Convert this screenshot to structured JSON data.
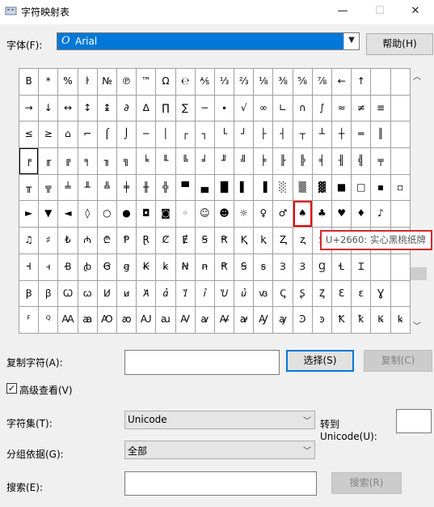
{
  "window": {
    "title": "字符映射表",
    "minimize": "—",
    "maximize": "☐",
    "close": "✕"
  },
  "font_label": "字体(F):",
  "font_value": "Arial",
  "font_icon": "O",
  "help_button": "帮助(H)",
  "grid_rows": [
    [
      "B",
      "*",
      "%",
      "ŀ",
      "№",
      "℗",
      "™",
      "Ω",
      "℮",
      "⅍",
      "⅓",
      "⅔",
      "⅛",
      "⅜",
      "⅝",
      "⅞",
      "←",
      "↑"
    ],
    [
      "→",
      "↓",
      "↔",
      "↕",
      "↨",
      "∂",
      "∆",
      "∏",
      "∑",
      "−",
      "∙",
      "√",
      "∞",
      "∟",
      "∩",
      "∫",
      "≈",
      "≠",
      "≡"
    ],
    [
      "≤",
      "≥",
      "⌂",
      "⌐",
      "⌠",
      "⌡",
      "─",
      "│",
      "┌",
      "┐",
      "└",
      "┘",
      "├",
      "┤",
      "┬",
      "┴",
      "┼",
      "═",
      "║"
    ],
    [
      "╒",
      "╓",
      "╔",
      "╕",
      "╖",
      "╗",
      "╘",
      "╙",
      "╚",
      "╛",
      "╜",
      "╝",
      "╞",
      "╟",
      "╠",
      "╡",
      "╢",
      "╣",
      "╤"
    ],
    [
      "╥",
      "╦",
      "╧",
      "╨",
      "╩",
      "╪",
      "╫",
      "╬",
      "▀",
      "▄",
      "█",
      "▌",
      "▐",
      "░",
      "▒",
      "▓",
      "■",
      "□",
      "▪",
      "▫",
      "▬",
      "▲"
    ],
    [
      "►",
      "▼",
      "◄",
      "◊",
      "○",
      "●",
      "◘",
      "◙",
      "◦",
      "☺",
      "☻",
      "☼",
      "♀",
      "♂",
      "♠",
      "♣",
      "♥",
      "♦",
      "♪"
    ],
    [
      "♫",
      "♯",
      "₺",
      "₼",
      "₾",
      "Ᵽ",
      "Ɽ",
      "Ȼ",
      "Ɇ",
      "Ꞩ",
      "Ꞧ",
      "Ⱪ",
      "ⱪ",
      "Ⱬ",
      "ⱬ",
      "Ȿ",
      "Ɀ",
      "Ɒ",
      "Ɐ",
      "Ɑ",
      "Ɱ"
    ],
    [
      "Ꟶ",
      "ꟶ",
      "Ꞗ",
      "ꞗ",
      "Ꞡ",
      "ꞡ",
      "Ꞣ",
      "ꞣ",
      "Ꞥ",
      "ꞥ",
      "Ꞧ",
      "Ꞩ",
      "ꞩ",
      "Ɜ",
      "Ɜ",
      "Ɡ",
      "Ɬ",
      "Ɪ"
    ],
    [
      "Ꞵ",
      "ꞵ",
      "Ꞷ",
      "ꞷ",
      "Ꞹ",
      "ꞹ",
      "Ꞻ",
      "ꞻ",
      "Ꞽ",
      "ꞽ",
      "Ꞿ",
      "ꞿ",
      "ꟃ",
      "Ꞔ",
      "Ʂ",
      "Ᶎ",
      "Ɛ",
      "ɛ",
      "Ɣ"
    ],
    [
      "ꟳ",
      "ꟴ",
      "Ꜳ",
      "ꜳ",
      "Ꜵ",
      "ꜵ",
      "Ꜷ",
      "ꜷ",
      "Ꜹ",
      "ꜹ",
      "Ꜻ",
      "ꜻ",
      "Ꜽ",
      "ꜽ",
      "Ꜿ",
      "ꜿ",
      "Ꝁ",
      "ꝁ",
      "Ꝃ",
      "ꝃ"
    ]
  ],
  "selected_char": "♠",
  "tooltip": "U+2660: 实心黑桃纸牌",
  "copy_label": "复制字符(A):",
  "copy_value": "",
  "select_button": "选择(S)",
  "copy_button": "复制(C)",
  "advanced_label": "高级查看(V)",
  "advanced_checked": "✓",
  "charset_label": "字符集(T):",
  "charset_value": "Unicode",
  "goto_label_1": "转到",
  "goto_label_2": "Unicode(U):",
  "goto_value": "",
  "group_label": "分组依据(G):",
  "group_value": "全部",
  "search_label": "搜索(E):",
  "search_value": "",
  "search_button": "搜索(R)",
  "colors": {
    "accent": "#0078d7",
    "highlight": "#d42a2a"
  }
}
